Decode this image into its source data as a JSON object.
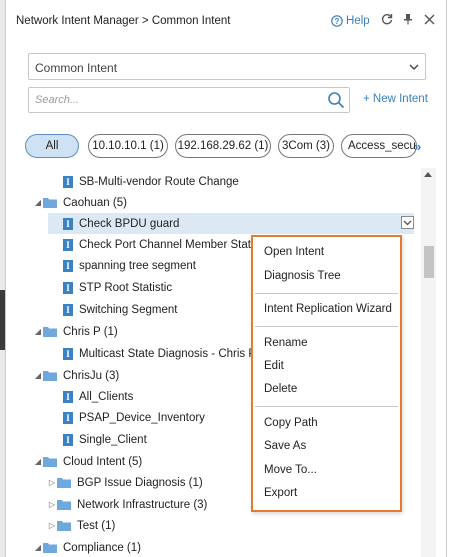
{
  "window": {
    "title": "Network Intent Manager > Common Intent",
    "help_label": "Help"
  },
  "selector": {
    "value": "Common Intent"
  },
  "search": {
    "placeholder": "Search...",
    "new_intent_label": "+ New Intent"
  },
  "filters": [
    {
      "label": "All",
      "active": true
    },
    {
      "label": "10.10.10.1 (1)",
      "active": false
    },
    {
      "label": "192.168.29.62 (1)",
      "active": false
    },
    {
      "label": "3Com (3)",
      "active": false
    },
    {
      "label": "Access_secu",
      "active": false
    }
  ],
  "tree": [
    {
      "label": "SB-Multi-vendor Route Change",
      "kind": "intent"
    },
    {
      "label": "Caohuan (5)",
      "kind": "folder",
      "expanded": true
    },
    {
      "label": "Check BPDU guard",
      "kind": "intent",
      "selected": true
    },
    {
      "label": "Check Port Channel Member Status",
      "kind": "intent"
    },
    {
      "label": "spanning tree segment",
      "kind": "intent"
    },
    {
      "label": "STP Root Statistic",
      "kind": "intent"
    },
    {
      "label": "Switching Segment",
      "kind": "intent"
    },
    {
      "label": "Chris P (1)",
      "kind": "folder",
      "expanded": true
    },
    {
      "label": "Multicast State Diagnosis - Chris P",
      "kind": "intent"
    },
    {
      "label": "ChrisJu (3)",
      "kind": "folder",
      "expanded": true
    },
    {
      "label": "All_Clients",
      "kind": "intent"
    },
    {
      "label": "PSAP_Device_Inventory",
      "kind": "intent"
    },
    {
      "label": "Single_Client",
      "kind": "intent"
    },
    {
      "label": "Cloud Intent (5)",
      "kind": "folder",
      "expanded": true
    },
    {
      "label": "BGP Issue Diagnosis (1)",
      "kind": "folder",
      "expanded": false
    },
    {
      "label": "Network Infrastructure (3)",
      "kind": "folder",
      "expanded": false
    },
    {
      "label": "Test (1)",
      "kind": "folder",
      "expanded": false
    },
    {
      "label": "Compliance (1)",
      "kind": "folder",
      "expanded": true
    }
  ],
  "context_menu": {
    "items": [
      "Open Intent",
      "Diagnosis Tree",
      "Intent Replication Wizard",
      "Rename",
      "Edit",
      "Delete",
      "Copy Path",
      "Save As",
      "Move To...",
      "Export"
    ]
  },
  "colors": {
    "accent": "#3a7fc1",
    "menu_border": "#e57b2d",
    "selected_row": "#dce9f5",
    "intent_icon": "#3b82c4",
    "folder": "#6fa8dc"
  },
  "icons": {
    "help": "help-circle-icon",
    "refresh": "refresh-icon",
    "pin": "pin-icon",
    "close": "close-icon",
    "search": "magnifier-icon",
    "more": "double-chevron-right-icon"
  }
}
